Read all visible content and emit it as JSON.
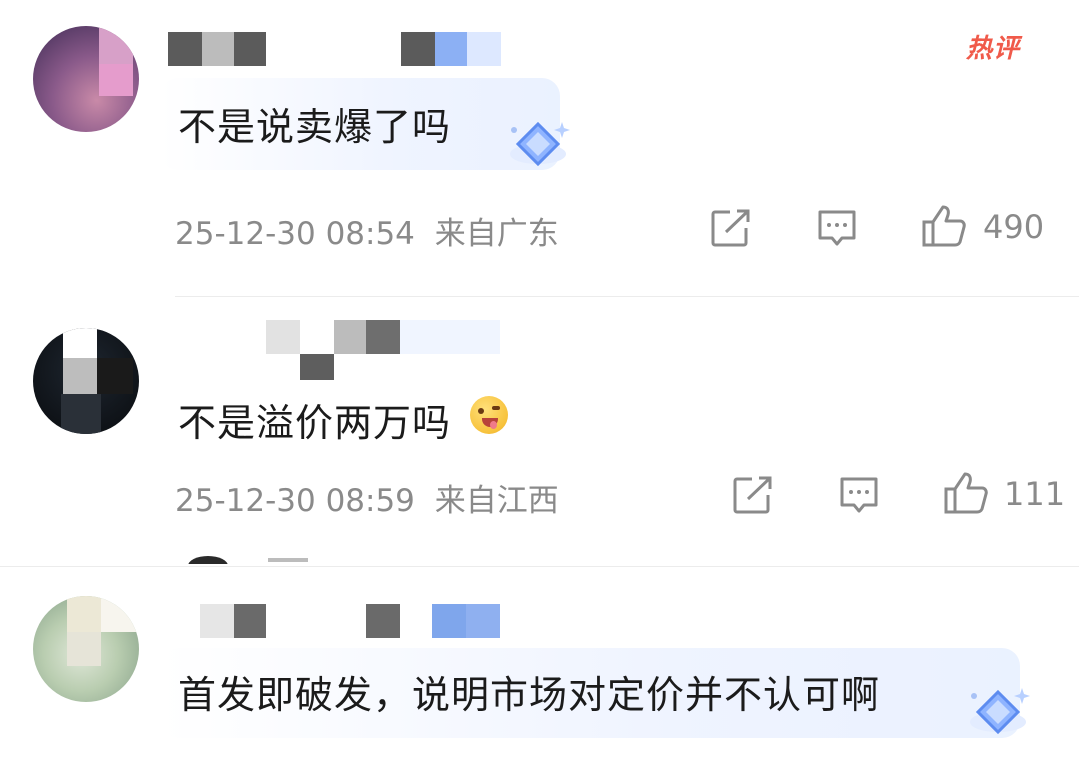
{
  "badge": {
    "hot_label": "热评"
  },
  "comments": [
    {
      "text": "不是说卖爆了吗",
      "time": "25-12-30 08:54",
      "location": "来自广东",
      "likes": "490"
    },
    {
      "text": "不是溢价两万吗",
      "emoji": "drooling-face",
      "time": "25-12-30 08:59",
      "location": "来自江西",
      "likes": "111"
    },
    {
      "text": "首发即破发，说明市场对定价并不认可啊"
    }
  ],
  "icons": [
    "share-icon",
    "comment-icon",
    "like-icon",
    "diamond-badge-icon"
  ]
}
